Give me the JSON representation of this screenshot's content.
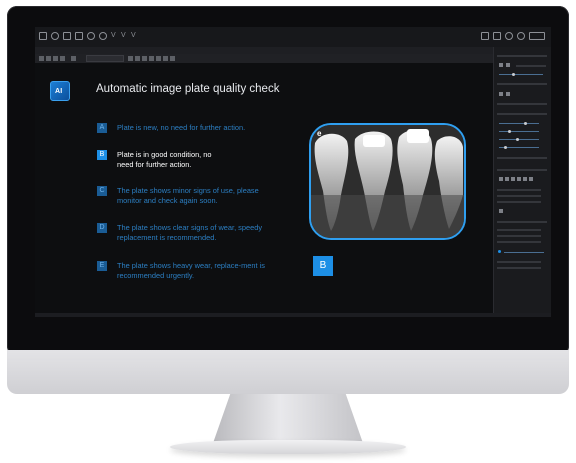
{
  "app": {
    "toolbar_left_icons": [
      "window-icon",
      "users-icon",
      "image-icon",
      "layers-icon",
      "settings-icon",
      "help-icon",
      "chevron-icon",
      "v-icon",
      "vv-icon"
    ],
    "toolbar_right_icons": [
      "monitor-icon",
      "transfer-icon",
      "globe-icon",
      "power-icon",
      "logo-icon"
    ],
    "menubar_label": "",
    "subbar_dropdown": "",
    "accent_color": "#1d8fe6"
  },
  "slide": {
    "title": "Automatic image plate quality check",
    "ai_label": "AI",
    "options": [
      {
        "letter": "A",
        "text": "Plate is new, no need for further action."
      },
      {
        "letter": "B",
        "text": "Plate is in good condition, no need for further action.",
        "active": true
      },
      {
        "letter": "C",
        "text": "The plate shows minor signs of use, please monitor and check again soon."
      },
      {
        "letter": "D",
        "text": "The plate shows clear signs of wear, speedy replacement is recommended."
      },
      {
        "letter": "E",
        "text": "The plate shows heavy wear, replace-ment is recommended urgently."
      }
    ],
    "xray_corner_label": "e",
    "result": "B"
  }
}
